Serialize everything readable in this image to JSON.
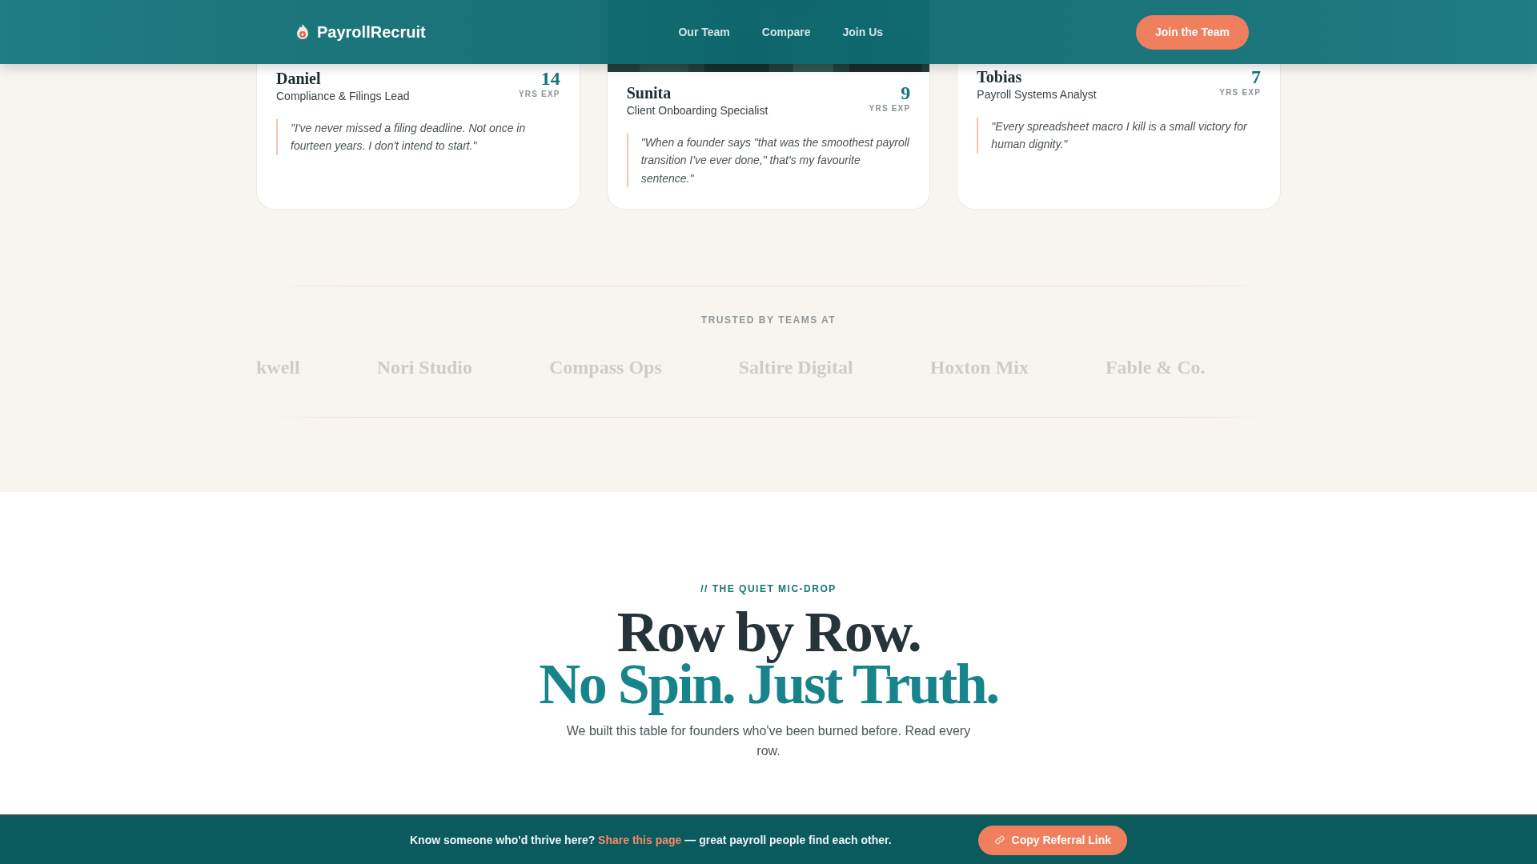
{
  "header": {
    "brand": "PayrollRecruit",
    "nav": [
      {
        "label": "Our Team"
      },
      {
        "label": "Compare"
      },
      {
        "label": "Join Us"
      }
    ],
    "cta": "Join the Team"
  },
  "team": [
    {
      "name": "Daniel",
      "role": "Compliance & Filings Lead",
      "years": "14",
      "years_label": "YRS EXP",
      "quote": "\"I've never missed a filing deadline. Not once in fourteen years. I don't intend to start.\""
    },
    {
      "name": "Sunita",
      "role": "Client Onboarding Specialist",
      "years": "9",
      "years_label": "YRS EXP",
      "quote": "\"When a founder says \"that was the smoothest payroll transition I've ever done,\" that's my favourite sentence.\"",
      "picture": true
    },
    {
      "name": "Tobias",
      "role": "Payroll Systems Analyst",
      "years": "7",
      "years_label": "YRS EXP",
      "quote": "\"Every spreadsheet macro I kill is a small victory for human dignity.\""
    }
  ],
  "trusted": {
    "label": "TRUSTED BY TEAMS AT",
    "logos": [
      "kwell",
      "Nori Studio",
      "Compass Ops",
      "Saltire Digital",
      "Hoxton Mix",
      "Fable & Co."
    ]
  },
  "compare_intro": {
    "eyebrow": "// THE QUIET MIC-DROP",
    "heading": "Row by Row.",
    "heading_accent": "No Spin. Just Truth.",
    "text": "We built this table for founders who've been burned before. Read every row."
  },
  "referral_bar": {
    "text_before": "Know someone who'd thrive here?",
    "link": "Share this page",
    "text_after": "— great payroll people find each other.",
    "button": "Copy Referral Link"
  }
}
